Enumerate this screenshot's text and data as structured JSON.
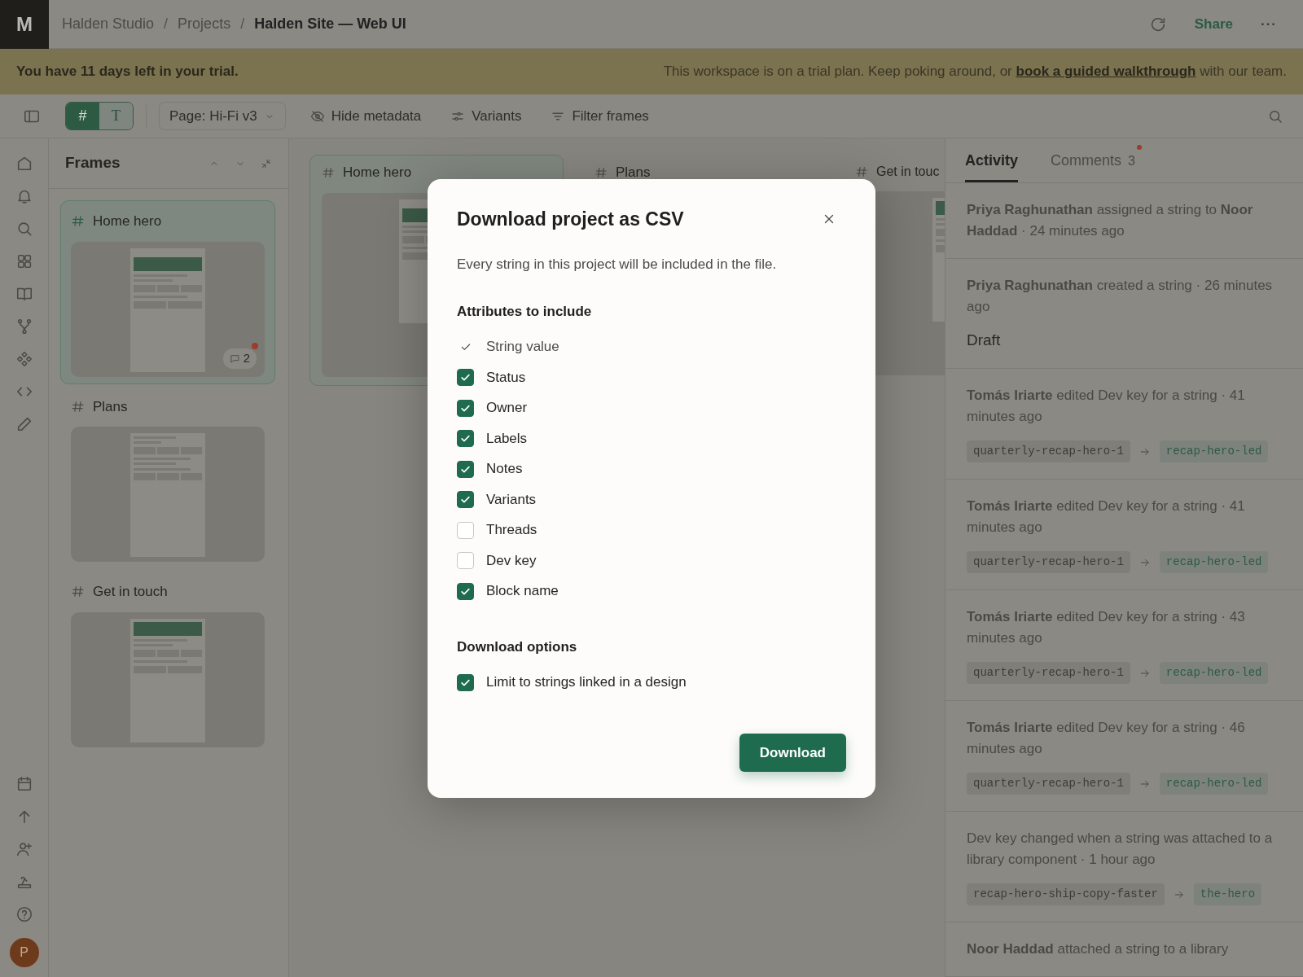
{
  "topbar": {
    "logo": "M",
    "breadcrumb": [
      {
        "label": "Halden Studio",
        "current": false
      },
      {
        "label": "Projects",
        "current": false
      },
      {
        "label": "Halden Site — Web UI",
        "current": true
      }
    ],
    "separator": "/",
    "share": "Share",
    "more": "···"
  },
  "banner": {
    "message": "You have 11 days left in your trial.",
    "note": "This workspace is on a trial plan. Keep poking around, or",
    "link": "book a guided walkthrough",
    "note_end": "with our team."
  },
  "toolbar": {
    "view_toggle": [
      {
        "label": "#",
        "selected": true
      },
      {
        "label": "T",
        "selected": false
      }
    ],
    "page_select": "Page: Hi-Fi v3",
    "actions": [
      {
        "label": "Hide metadata"
      },
      {
        "label": "Variants"
      },
      {
        "label": "Filter frames"
      }
    ]
  },
  "rail": {
    "avatar": "P"
  },
  "frames_panel": {
    "title": "Frames",
    "frames": [
      {
        "name": "Home hero",
        "selected": true,
        "comments": "2",
        "unread": true
      },
      {
        "name": "Plans",
        "selected": false
      },
      {
        "name": "Get in touch",
        "selected": false
      }
    ]
  },
  "canvas": {
    "frames": [
      {
        "name": "Home hero",
        "selected": true
      },
      {
        "name": "Plans",
        "selected": false
      },
      {
        "name": "Get in touc",
        "selected": false
      }
    ]
  },
  "activity_panel": {
    "tabs": [
      {
        "label": "Activity",
        "selected": true
      },
      {
        "label": "Comments",
        "count": "3",
        "unread": true,
        "selected": false
      }
    ],
    "entries": [
      {
        "text": "**Priya Raghunathan** assigned a string to **Noor Haddad** · 24 minutes ago"
      },
      {
        "text": "**Priya Raghunathan** created a string · 26 minutes ago",
        "detail": "Draft"
      },
      {
        "text": "**Tomás Iriarte** edited Dev key for a string · 41 minutes ago",
        "from": "quarterly-recap-hero-1",
        "to": "recap-hero-led"
      },
      {
        "text": "**Tomás Iriarte** edited Dev key for a string · 41 minutes ago",
        "from": "quarterly-recap-hero-1",
        "to": "recap-hero-led"
      },
      {
        "text": "**Tomás Iriarte** edited Dev key for a string · 43 minutes ago",
        "from": "quarterly-recap-hero-1",
        "to": "recap-hero-led"
      },
      {
        "text": "**Tomás Iriarte** edited Dev key for a string · 46 minutes ago",
        "from": "quarterly-recap-hero-1",
        "to": "recap-hero-led"
      },
      {
        "text": "Dev key changed when a string was attached to a library component · 1 hour ago",
        "from": "recap-hero-ship-copy-faster",
        "to": "the-hero"
      },
      {
        "text": "**Noor Haddad** attached a string to a library"
      }
    ]
  },
  "dialog": {
    "title": "Download project as CSV",
    "description": "Every string in this project will be included in the file.",
    "sections": [
      {
        "title": "Attributes to include",
        "options": [
          {
            "label": "String value",
            "kind": "locked"
          },
          {
            "label": "Status",
            "kind": "checkbox",
            "checked": true
          },
          {
            "label": "Owner",
            "kind": "checkbox",
            "checked": true
          },
          {
            "label": "Labels",
            "kind": "checkbox",
            "checked": true
          },
          {
            "label": "Notes",
            "kind": "checkbox",
            "checked": true
          },
          {
            "label": "Variants",
            "kind": "checkbox",
            "checked": true
          },
          {
            "label": "Threads",
            "kind": "checkbox",
            "checked": false
          },
          {
            "label": "Dev key",
            "kind": "checkbox",
            "checked": false
          },
          {
            "label": "Block name",
            "kind": "checkbox",
            "checked": true
          }
        ]
      },
      {
        "title": "Download options",
        "options": [
          {
            "label": "Limit to strings linked in a design",
            "kind": "checkbox",
            "checked": true
          }
        ]
      }
    ],
    "primary_button": "Download"
  }
}
